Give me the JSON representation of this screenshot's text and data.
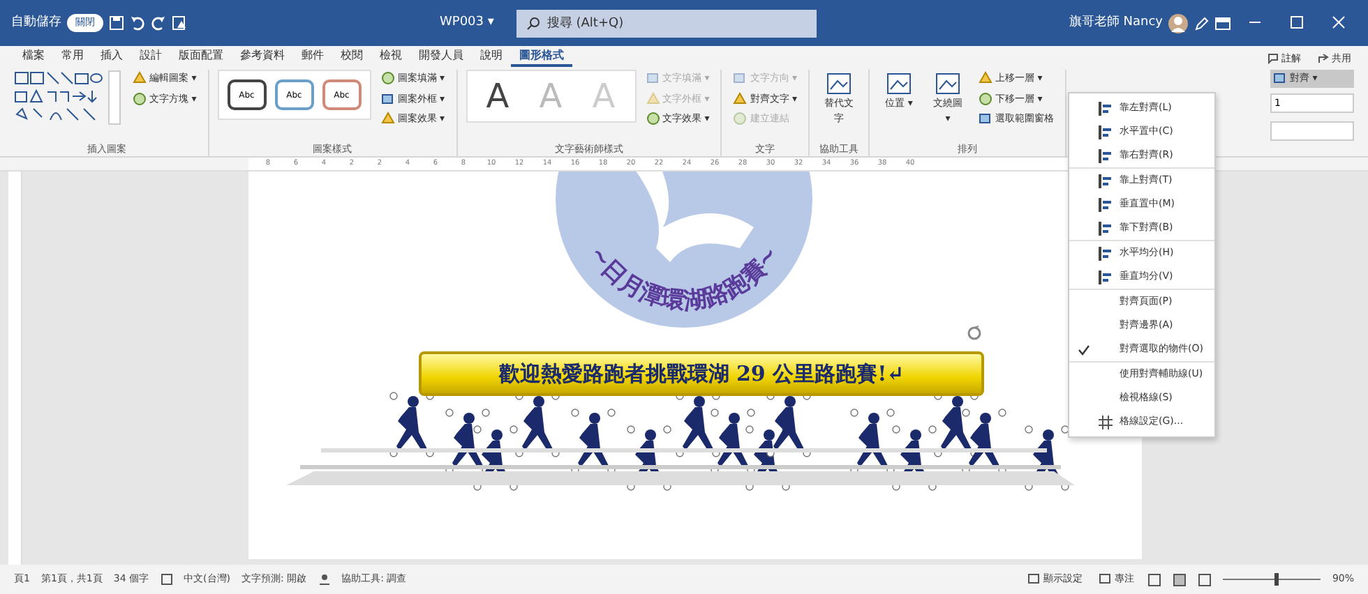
{
  "title_bar": {
    "autosave_label": "自動儲存",
    "autosave_toggle": {
      "label": "關閉",
      "on": false
    },
    "doc_title": "WP003 ▾",
    "search": {
      "placeholder": "搜尋 (Alt+Q)"
    },
    "user": "旗哥老師 Nancy"
  },
  "tabs": [
    {
      "label": "檔案",
      "selected": false
    },
    {
      "label": "常用",
      "selected": false
    },
    {
      "label": "插入",
      "selected": false
    },
    {
      "label": "設計",
      "selected": false
    },
    {
      "label": "版面配置",
      "selected": false
    },
    {
      "label": "參考資料",
      "selected": false
    },
    {
      "label": "郵件",
      "selected": false
    },
    {
      "label": "校閱",
      "selected": false
    },
    {
      "label": "檢視",
      "selected": false
    },
    {
      "label": "開發人員",
      "selected": false
    },
    {
      "label": "說明",
      "selected": false
    },
    {
      "label": "圖形格式",
      "selected": true
    }
  ],
  "tab_actions": [
    "註解",
    "共用"
  ],
  "ribbon": [
    {
      "label": "插入圖案",
      "controls": [
        {
          "kind": "shapes"
        },
        {
          "kind": "small",
          "label": "編輯圖案 ▾",
          "disabled": false
        },
        {
          "kind": "small",
          "label": "文字方塊 ▾",
          "disabled": false
        }
      ]
    },
    {
      "label": "圖案樣式",
      "controls": [
        {
          "kind": "styles",
          "samples": [
            "Abc",
            "Abc",
            "Abc"
          ]
        },
        {
          "kind": "small",
          "label": "圖案填滿 ▾",
          "disabled": false
        },
        {
          "kind": "small",
          "label": "圖案外框 ▾",
          "disabled": false
        },
        {
          "kind": "small",
          "label": "圖案效果 ▾",
          "disabled": false
        }
      ]
    },
    {
      "label": "文字藝術師樣式",
      "controls": [
        {
          "kind": "wordart",
          "samples": [
            "A",
            "A",
            "A"
          ]
        },
        {
          "kind": "small",
          "label": "文字填滿 ▾",
          "disabled": true
        },
        {
          "kind": "small",
          "label": "文字外框 ▾",
          "disabled": true
        },
        {
          "kind": "small",
          "label": "文字效果 ▾",
          "disabled": false
        }
      ]
    },
    {
      "label": "文字",
      "controls": [
        {
          "kind": "small",
          "label": "文字方向 ▾",
          "disabled": true
        },
        {
          "kind": "small",
          "label": "對齊文字 ▾",
          "disabled": false
        },
        {
          "kind": "small",
          "label": "建立連結",
          "disabled": true
        }
      ]
    },
    {
      "label": "協助工具",
      "controls": [
        {
          "kind": "large",
          "label": "替代文字",
          "disabled": false
        }
      ]
    },
    {
      "label": "排列",
      "controls": [
        {
          "kind": "large",
          "label": "位置 ▾",
          "disabled": false
        },
        {
          "kind": "large",
          "label": "文繞圖 ▾",
          "disabled": false
        },
        {
          "kind": "small",
          "label": "上移一層 ▾",
          "disabled": false
        },
        {
          "kind": "small",
          "label": "下移一層 ▾",
          "disabled": false
        },
        {
          "kind": "small",
          "label": "選取範圍窗格",
          "disabled": false
        }
      ]
    },
    {
      "controls": [
        {
          "kind": "small",
          "label": "對齊 ▾",
          "disabled": false,
          "selected": true
        },
        {
          "kind": "size",
          "label": "1"
        },
        {
          "kind": "size"
        }
      ]
    }
  ],
  "ruler": [
    "8",
    "6",
    "4",
    "2",
    "2",
    "4",
    "6",
    "8",
    "10",
    "12",
    "14",
    "16",
    "18",
    "20",
    "22",
    "24",
    "26",
    "28",
    "30",
    "32",
    "34",
    "36",
    "38",
    "40"
  ],
  "document": {
    "logo_text": "~日月潭環湖路跑賽~",
    "banner": "歡迎熱愛路跑者挑戰環湖 29 公里路跑賽!↵"
  },
  "align_menu": {
    "sections": [
      [
        {
          "label": "靠左對齊(L)",
          "checked": false,
          "kind": "icon"
        },
        {
          "label": "水平置中(C)",
          "checked": false,
          "kind": "icon"
        },
        {
          "label": "靠右對齊(R)",
          "checked": false,
          "kind": "icon"
        }
      ],
      [
        {
          "label": "靠上對齊(T)",
          "checked": false,
          "kind": "icon"
        },
        {
          "label": "垂直置中(M)",
          "checked": false,
          "kind": "icon"
        },
        {
          "label": "靠下對齊(B)",
          "checked": false,
          "kind": "icon"
        }
      ],
      [
        {
          "label": "水平均分(H)",
          "checked": false,
          "kind": "icon"
        },
        {
          "label": "垂直均分(V)",
          "checked": false,
          "kind": "icon"
        }
      ],
      [
        {
          "label": "對齊頁面(P)",
          "checked": false,
          "kind": "text"
        },
        {
          "label": "對齊邊界(A)",
          "checked": false,
          "kind": "text"
        },
        {
          "label": "對齊選取的物件(O)",
          "checked": true,
          "kind": "text"
        }
      ],
      [
        {
          "label": "使用對齊輔助線(U)",
          "checked": false,
          "kind": "text"
        },
        {
          "label": "檢視格線(S)",
          "checked": false,
          "kind": "text"
        },
        {
          "label": "格線設定(G)...",
          "checked": false,
          "kind": "grid"
        }
      ]
    ]
  },
  "status_bar": {
    "left": [
      "頁1",
      "第1頁，共1頁",
      "34 個字",
      "中文(台灣)",
      "文字預測: 開啟",
      "協助工具: 調查"
    ],
    "right": [
      "顯示設定",
      "專注"
    ],
    "zoom": {
      "level": 0.55,
      "label": "90%"
    }
  }
}
